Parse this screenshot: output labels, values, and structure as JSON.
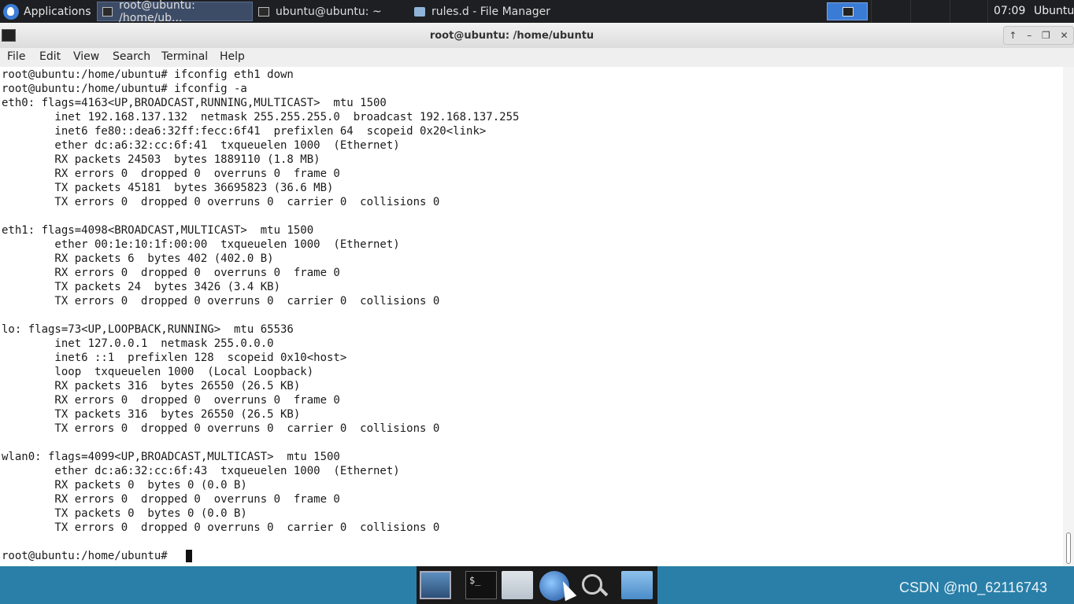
{
  "top_panel": {
    "applications_label": "Applications",
    "tasks": [
      {
        "label": "root@ubuntu: /home/ub...",
        "icon": "terminal-icon"
      },
      {
        "label": "ubuntu@ubuntu: ~",
        "icon": "terminal-icon"
      },
      {
        "label": "rules.d - File Manager",
        "icon": "folder-icon"
      }
    ],
    "clock": "07:09",
    "user": "Ubuntu"
  },
  "window": {
    "title": "root@ubuntu: /home/ubuntu",
    "controls": [
      "↑",
      "–",
      "❐",
      "✕"
    ]
  },
  "menu": [
    "File",
    "Edit",
    "View",
    "Search",
    "Terminal",
    "Help"
  ],
  "terminal": {
    "lines": [
      "root@ubuntu:/home/ubuntu# ifconfig eth1 down",
      "root@ubuntu:/home/ubuntu# ifconfig -a",
      "eth0: flags=4163<UP,BROADCAST,RUNNING,MULTICAST>  mtu 1500",
      "        inet 192.168.137.132  netmask 255.255.255.0  broadcast 192.168.137.255",
      "        inet6 fe80::dea6:32ff:fecc:6f41  prefixlen 64  scopeid 0x20<link>",
      "        ether dc:a6:32:cc:6f:41  txqueuelen 1000  (Ethernet)",
      "        RX packets 24503  bytes 1889110 (1.8 MB)",
      "        RX errors 0  dropped 0  overruns 0  frame 0",
      "        TX packets 45181  bytes 36695823 (36.6 MB)",
      "        TX errors 0  dropped 0 overruns 0  carrier 0  collisions 0",
      "",
      "eth1: flags=4098<BROADCAST,MULTICAST>  mtu 1500",
      "        ether 00:1e:10:1f:00:00  txqueuelen 1000  (Ethernet)",
      "        RX packets 6  bytes 402 (402.0 B)",
      "        RX errors 0  dropped 0  overruns 0  frame 0",
      "        TX packets 24  bytes 3426 (3.4 KB)",
      "        TX errors 0  dropped 0 overruns 0  carrier 0  collisions 0",
      "",
      "lo: flags=73<UP,LOOPBACK,RUNNING>  mtu 65536",
      "        inet 127.0.0.1  netmask 255.0.0.0",
      "        inet6 ::1  prefixlen 128  scopeid 0x10<host>",
      "        loop  txqueuelen 1000  (Local Loopback)",
      "        RX packets 316  bytes 26550 (26.5 KB)",
      "        RX errors 0  dropped 0  overruns 0  frame 0",
      "        TX packets 316  bytes 26550 (26.5 KB)",
      "        TX errors 0  dropped 0 overruns 0  carrier 0  collisions 0",
      "",
      "wlan0: flags=4099<UP,BROADCAST,MULTICAST>  mtu 1500",
      "        ether dc:a6:32:cc:6f:43  txqueuelen 1000  (Ethernet)",
      "        RX packets 0  bytes 0 (0.0 B)",
      "        RX errors 0  dropped 0  overruns 0  frame 0",
      "        TX packets 0  bytes 0 (0.0 B)",
      "        TX errors 0  dropped 0 overruns 0  carrier 0  collisions 0",
      "",
      "root@ubuntu:/home/ubuntu# "
    ]
  },
  "dock": {
    "terminal_glyph": "$_"
  },
  "watermark": "CSDN @m0_62116743",
  "colors": {
    "desktop": "#2a7fa8",
    "panel": "#1e1f22",
    "active_task": "#3d4c66",
    "workspace_pager": "#3a7bd5"
  }
}
